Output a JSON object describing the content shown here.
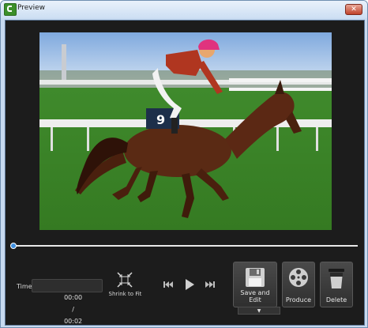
{
  "window": {
    "title": "Preview",
    "close_glyph": "✕"
  },
  "player": {
    "time_label": "Time",
    "current_time": "00:00",
    "separator": "/",
    "duration": "00:02",
    "progress_fraction": 0.0
  },
  "buttons": {
    "shrink_to_fit": "Shrink to Fit",
    "save_and_edit": "Save and Edit",
    "produce": "Produce",
    "delete": "Delete",
    "dropdown_arrow": "▼"
  },
  "icons": {
    "app": "camtasia-app-icon",
    "close": "close-icon",
    "shrink": "shrink-to-fit-icon",
    "prev": "skip-back-icon",
    "play": "play-icon",
    "next": "skip-forward-icon",
    "save": "floppy-disk-icon",
    "produce": "film-reel-icon",
    "delete": "trash-can-icon"
  },
  "colors": {
    "accent": "#3e8fe0",
    "background": "#1c1c1c",
    "titlebar": "#cddff3"
  }
}
